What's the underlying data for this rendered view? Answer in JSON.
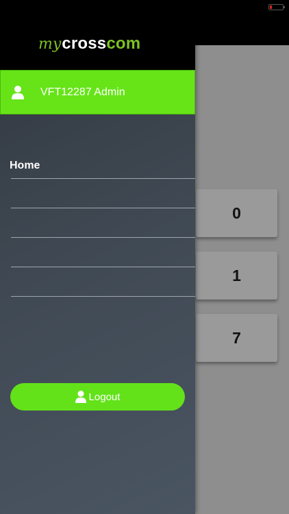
{
  "background": {
    "counters": [
      "0",
      "1",
      "7"
    ]
  },
  "drawer": {
    "logo": {
      "my": "my",
      "cross": "cross",
      "com": "com"
    },
    "user": {
      "name": "VFT12287 Admin",
      "icon": "user-icon"
    },
    "menu": [
      {
        "label": "Home"
      }
    ],
    "logout_label": "Logout",
    "colors": {
      "accent": "#66e418",
      "drawer_bg": "#3f4852"
    }
  }
}
